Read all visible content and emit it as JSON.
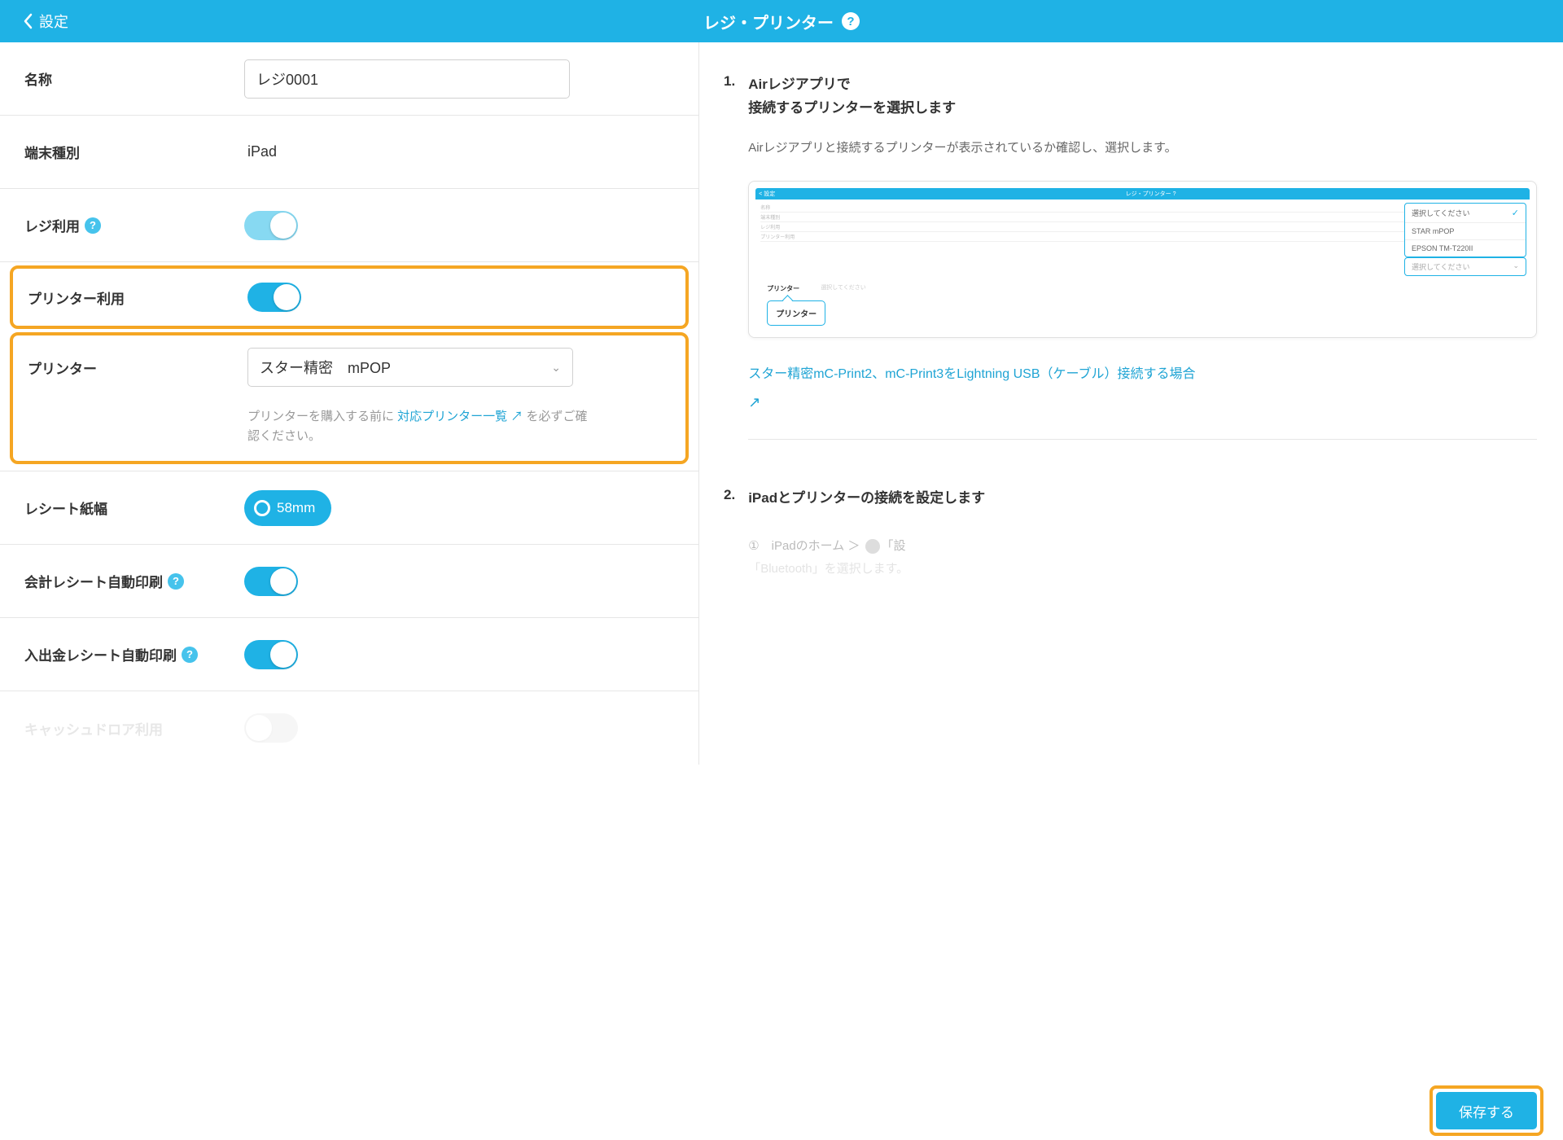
{
  "header": {
    "back_label": "設定",
    "title": "レジ・プリンター"
  },
  "fields": {
    "name_label": "名称",
    "name_value": "レジ0001",
    "device_type_label": "端末種別",
    "device_type_value": "iPad",
    "register_use_label": "レジ利用",
    "printer_use_label": "プリンター利用",
    "printer_label": "プリンター",
    "printer_value": "スター精密　mPOP",
    "printer_hint_pre": "プリンターを購入する前に ",
    "printer_hint_link": "対応プリンター一覧",
    "printer_hint_post": " を必ずご確認ください。",
    "receipt_width_label": "レシート紙幅",
    "receipt_width_value": "58mm",
    "auto_print_receipt_label": "会計レシート自動印刷",
    "auto_print_cash_label": "入出金レシート自動印刷",
    "cash_drawer_label": "キャッシュドロア利用"
  },
  "instructions": {
    "step1_num": "1.",
    "step1_title": "Airレジアプリで\n接続するプリンターを選択します",
    "step1_desc": "Airレジアプリと接続するプリンターが表示されているか確認し、選択します。",
    "diagram": {
      "header_left": "< 設定",
      "header_center": "レジ・プリンター ?",
      "popup_opt1": "選択してください",
      "popup_opt2": "STAR mPOP",
      "popup_opt3": "EPSON TM-T220II",
      "popup2_text": "選択してください",
      "callout": "プリンター",
      "label_printer": "プリンター",
      "row1": "名称",
      "row2": "端末種別",
      "row3": "レジ利用",
      "row4": "プリンター利用",
      "greyrow": "選択してください"
    },
    "side_link": "スター精密mC-Print2、mC-Print3をLightning USB（ケーブル）接続する場合",
    "step2_num": "2.",
    "step2_title": "iPadとプリンターの接続を設定します",
    "step2_faded_pre": "①　iPadのホーム ＞ ",
    "step2_faded_post": "「設",
    "step2_faded_line2": "「Bluetooth」を選択します。"
  },
  "footer": {
    "save_label": "保存する"
  }
}
